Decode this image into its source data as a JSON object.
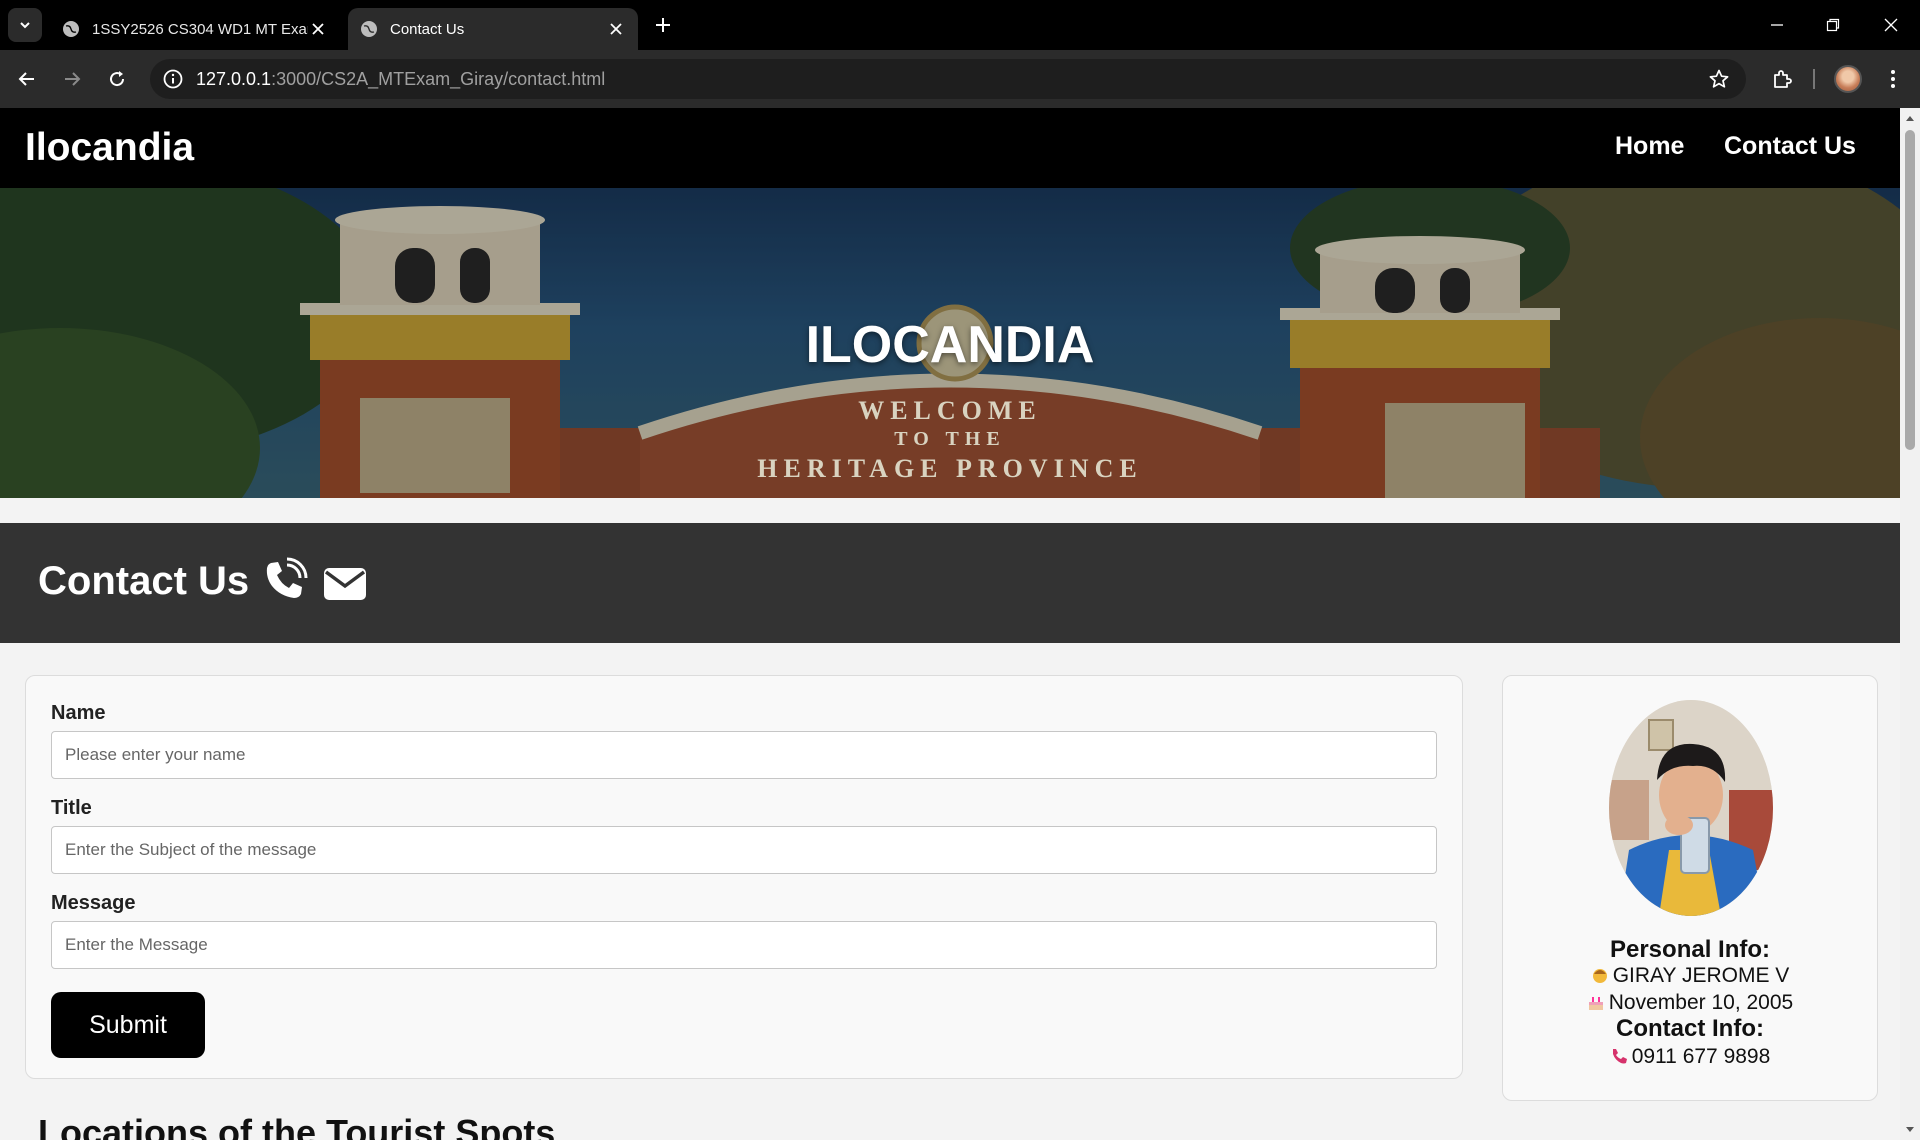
{
  "browser": {
    "tabs": [
      {
        "title": "1SSY2526 CS304 WD1 MT Exam",
        "active": false
      },
      {
        "title": "Contact Us",
        "active": true
      }
    ],
    "url_host": "127.0.0.1",
    "url_rest": ":3000/CS2A_MTExam_Giray/contact.html"
  },
  "nav": {
    "brand": "Ilocandia",
    "links": [
      "Home",
      "Contact Us"
    ]
  },
  "hero": {
    "title": "ILOCANDIA",
    "sign_lines": [
      "WELCOME",
      "TO THE",
      "HERITAGE PROVINCE"
    ]
  },
  "contact_section": {
    "heading": "Contact Us",
    "icons": [
      "phone-icon",
      "envelope-icon"
    ]
  },
  "form": {
    "name_label": "Name",
    "name_placeholder": "Please enter your name",
    "title_label": "Title",
    "title_placeholder": "Enter the Subject of the message",
    "message_label": "Message",
    "message_placeholder": "Enter the Message",
    "submit_label": "Submit"
  },
  "profile": {
    "personal_heading": "Personal Info:",
    "name": "GIRAY JEROME V",
    "birthday": "November 10, 2005",
    "contact_heading": "Contact Info:",
    "phone": "0911 677 9898"
  },
  "locations": {
    "heading": "Locations of the Tourist Spots"
  },
  "colors": {
    "nav_bg": "#000000",
    "band_bg": "#333333",
    "page_bg": "#f3f3f3",
    "button_bg": "#000000"
  }
}
